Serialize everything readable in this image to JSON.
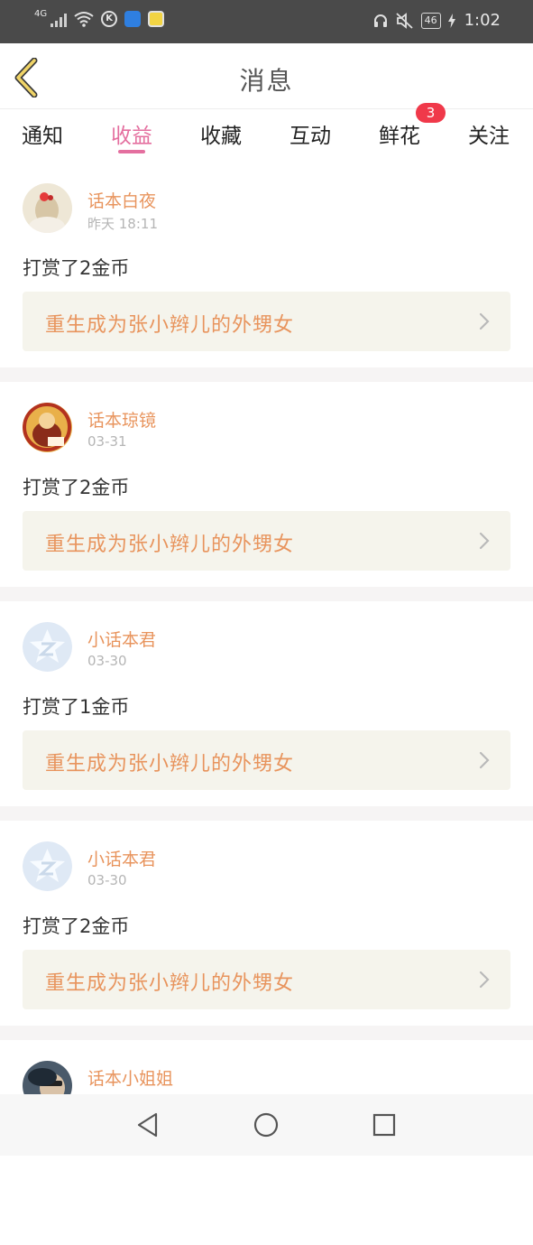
{
  "status_bar": {
    "network": "4G",
    "battery": "46",
    "time": "1:02",
    "icons": [
      "signal-icon",
      "wifi-icon",
      "k-app-icon",
      "blue-app-icon",
      "yellow-app-icon",
      "headphones-icon",
      "mute-icon",
      "battery-icon",
      "charging-icon"
    ]
  },
  "header": {
    "title": "消息",
    "back_icon": "chevron-left-icon"
  },
  "tabs": [
    {
      "label": "通知",
      "active": false
    },
    {
      "label": "收益",
      "active": true
    },
    {
      "label": "收藏",
      "active": false
    },
    {
      "label": "互动",
      "active": false
    },
    {
      "label": "鲜花",
      "active": false,
      "badge": "3"
    },
    {
      "label": "关注",
      "active": false
    }
  ],
  "messages": [
    {
      "username": "话本白夜",
      "time": "昨天 18:11",
      "text": "打赏了2金币",
      "book_title": "重生成为张小辫儿的外甥女",
      "avatar": "photo-avatar"
    },
    {
      "username": "话本琼镜",
      "time": "03-31",
      "text": "打赏了2金币",
      "book_title": "重生成为张小辫儿的外甥女",
      "avatar": "illustration-avatar"
    },
    {
      "username": "小话本君",
      "time": "03-30",
      "text": "打赏了1金币",
      "book_title": "重生成为张小辫儿的外甥女",
      "avatar": "default-z-avatar"
    },
    {
      "username": "小话本君",
      "time": "03-30",
      "text": "打赏了2金币",
      "book_title": "重生成为张小辫儿的外甥女",
      "avatar": "default-z-avatar"
    },
    {
      "username": "话本小姐姐",
      "avatar": "photo-avatar"
    }
  ],
  "colors": {
    "accent_pink": "#e46f9f",
    "username_orange": "#e8945d",
    "badge_red": "#f0394a",
    "book_box_bg": "#f5f4ec"
  },
  "system_nav": [
    "back-triangle-icon",
    "home-circle-icon",
    "recents-square-icon"
  ]
}
